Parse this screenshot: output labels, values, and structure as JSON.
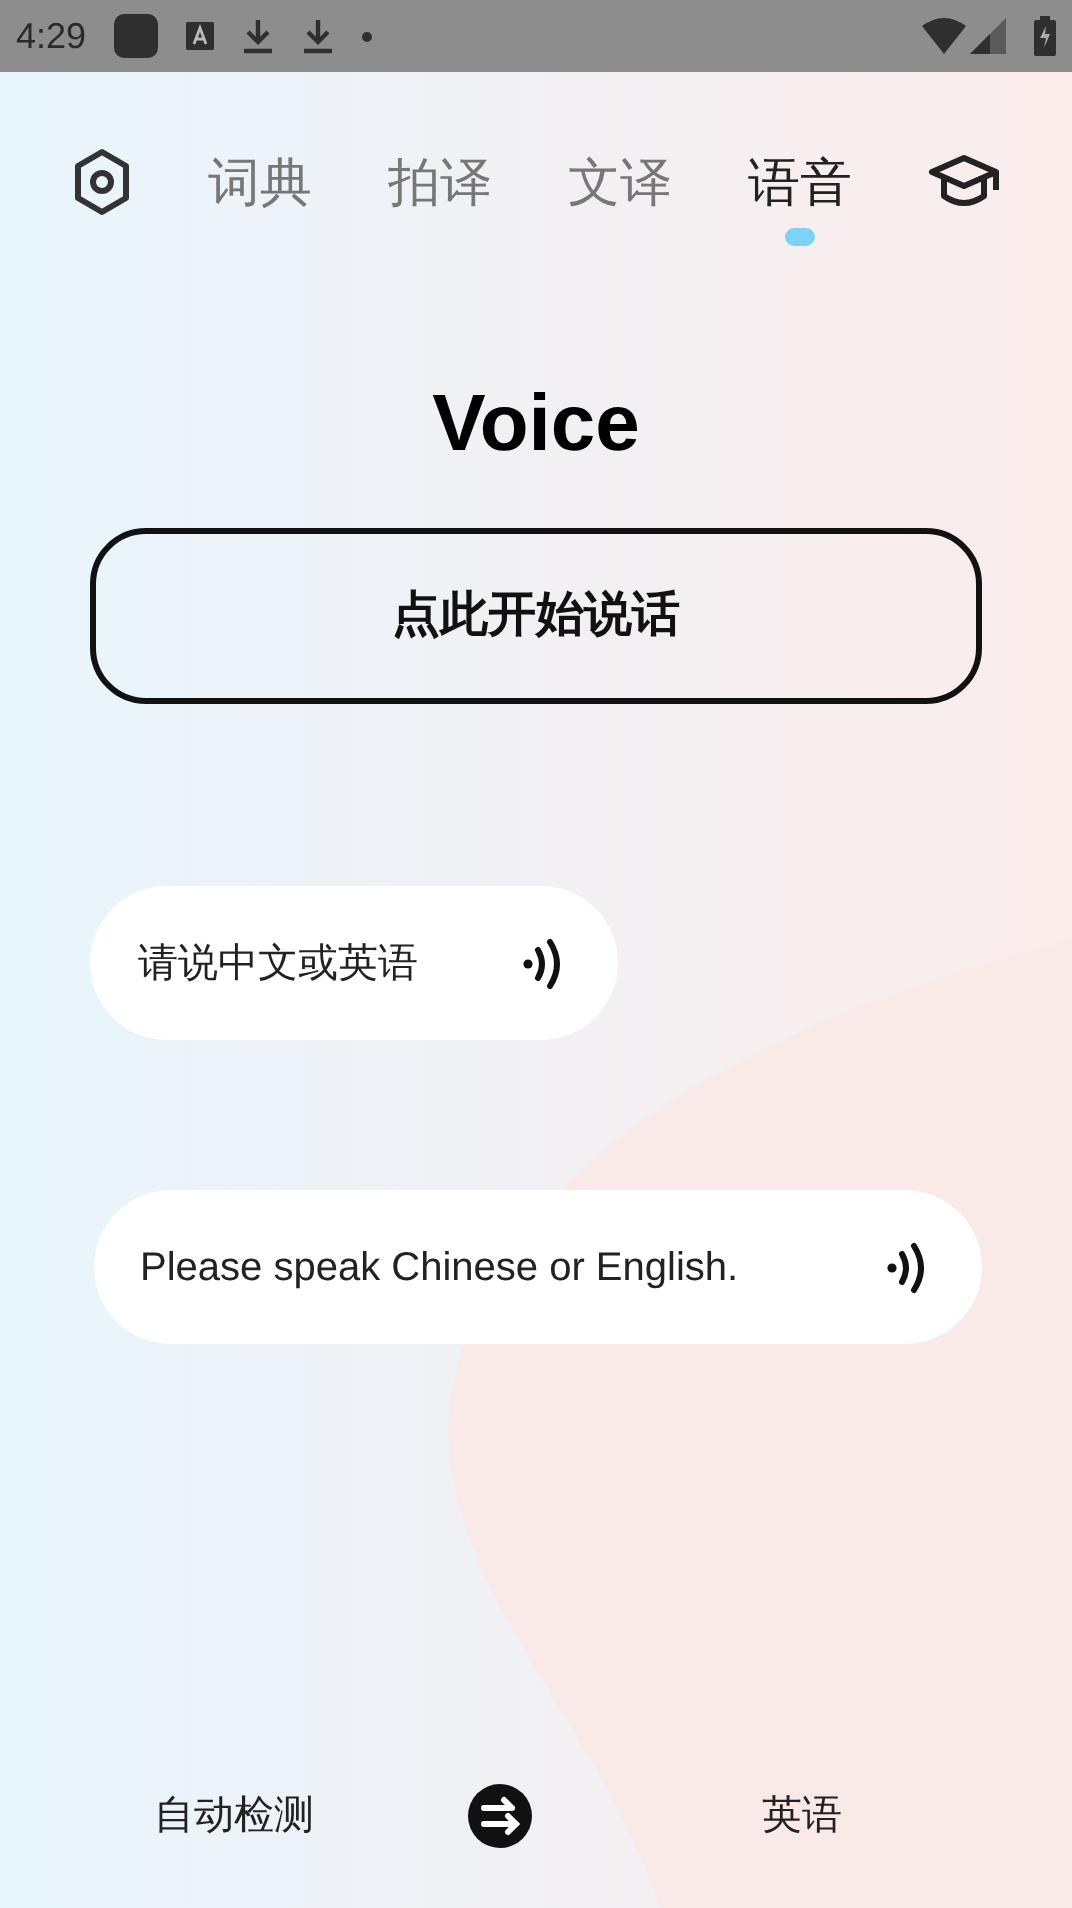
{
  "status_bar": {
    "time": "4:29"
  },
  "tabs": [
    {
      "label": "词典",
      "selected": false
    },
    {
      "label": "拍译",
      "selected": false
    },
    {
      "label": "文译",
      "selected": false
    },
    {
      "label": "语音",
      "selected": true
    }
  ],
  "title": "Voice",
  "talk_button": "点此开始说话",
  "bubbles": [
    {
      "text": "请说中文或英语"
    },
    {
      "text": "Please speak Chinese or English."
    }
  ],
  "languages": {
    "source": "自动检测",
    "target": "英语"
  }
}
